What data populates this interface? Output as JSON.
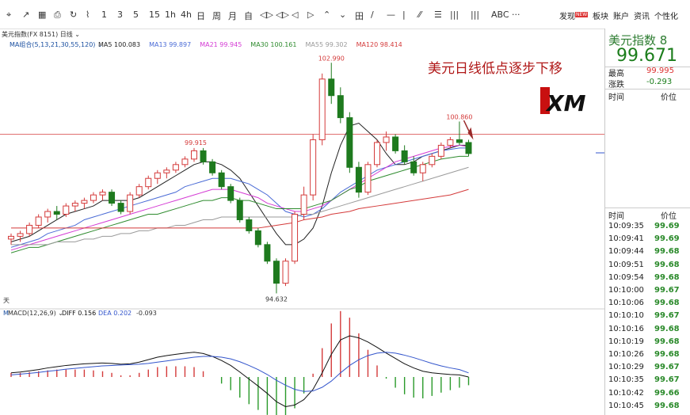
{
  "toolbar": {
    "icons": [
      "draw-crosshair-icon",
      "draw-ray-icon",
      "draw-box-icon",
      "save-icon",
      "refresh-icon",
      "chart-type-icon"
    ],
    "periods": [
      "1",
      "3",
      "5",
      "15",
      "1h",
      "4h",
      "日",
      "周",
      "月",
      "自",
      "◁▷",
      "◁▷",
      "◁",
      "▷",
      "⌃",
      "⌄",
      "田",
      "/",
      "—",
      "|",
      "⁄⁄",
      "☰",
      "|||",
      "|||",
      "ABC",
      "···"
    ],
    "right_items": [
      "发现",
      "板块",
      "账户",
      "资讯",
      "个性化"
    ],
    "discover_badge": "NEW"
  },
  "chart_header": {
    "symbol": "美元指数(FX 8151)",
    "period": "日线",
    "ma_label": "MA组合(5,13,21,30,55,120)",
    "ma_values": [
      {
        "name": "MA5",
        "value": "100.083",
        "color": "#222222"
      },
      {
        "name": "MA13",
        "value": "99.897",
        "color": "#4a6bd6"
      },
      {
        "name": "MA21",
        "value": "99.945",
        "color": "#d43bd4"
      },
      {
        "name": "MA30",
        "value": "100.161",
        "color": "#2e8b2e"
      },
      {
        "name": "MA55",
        "value": "99.302",
        "color": "#9a9a9a"
      },
      {
        "name": "MA120",
        "value": "98.414",
        "color": "#d43a3a"
      }
    ]
  },
  "annotation": {
    "headline": "美元日线低点逐步下移",
    "brand": "XM",
    "high_label": "102.990",
    "left_peak_label": "99.915",
    "low_label": "94.632",
    "recent_label": "100.860",
    "tian": "天"
  },
  "macd_header": {
    "label": "MACD(12,26,9)",
    "diff_name": "DIFF",
    "diff_value": "0.156",
    "dea_name": "DEA",
    "dea_value": "0.202",
    "macd_value": "-0.093"
  },
  "side": {
    "title": "美元指数",
    "title_suffix": "8",
    "price": "99.671",
    "high_label": "最高",
    "high_value": "99.995",
    "chg_label": "涨跌",
    "chg_value": "-0.293",
    "col_time": "时间",
    "col_price": "价位",
    "col_time2": "时间",
    "col_price2": "价位",
    "ticks": [
      {
        "t": "10:09:35",
        "p": "99.69"
      },
      {
        "t": "10:09:41",
        "p": "99.69"
      },
      {
        "t": "10:09:44",
        "p": "99.68"
      },
      {
        "t": "10:09:51",
        "p": "99.68"
      },
      {
        "t": "10:09:54",
        "p": "99.68"
      },
      {
        "t": "10:10:00",
        "p": "99.67"
      },
      {
        "t": "10:10:06",
        "p": "99.68"
      },
      {
        "t": "10:10:10",
        "p": "99.67"
      },
      {
        "t": "10:10:16",
        "p": "99.68"
      },
      {
        "t": "10:10:19",
        "p": "99.68"
      },
      {
        "t": "10:10:26",
        "p": "99.68"
      },
      {
        "t": "10:10:29",
        "p": "99.67"
      },
      {
        "t": "10:10:35",
        "p": "99.67"
      },
      {
        "t": "10:10:42",
        "p": "99.66"
      },
      {
        "t": "10:10:45",
        "p": "99.68"
      }
    ]
  },
  "chart_data": {
    "type": "candlestick",
    "ylim": [
      94.3,
      103.6
    ],
    "resistance_level": 100.4,
    "candles": [
      [
        96.6,
        96.8,
        96.4,
        96.7
      ],
      [
        96.7,
        96.9,
        96.5,
        96.8
      ],
      [
        96.8,
        97.2,
        96.7,
        97.1
      ],
      [
        97.1,
        97.5,
        97.0,
        97.4
      ],
      [
        97.4,
        97.7,
        97.2,
        97.6
      ],
      [
        97.6,
        97.8,
        97.3,
        97.5
      ],
      [
        97.5,
        97.9,
        97.4,
        97.8
      ],
      [
        97.8,
        98.0,
        97.6,
        97.9
      ],
      [
        97.9,
        98.1,
        97.7,
        98.0
      ],
      [
        98.0,
        98.3,
        97.9,
        98.2
      ],
      [
        98.2,
        98.4,
        98.0,
        98.3
      ],
      [
        98.3,
        98.4,
        97.8,
        97.9
      ],
      [
        97.9,
        98.0,
        97.5,
        97.6
      ],
      [
        97.6,
        98.3,
        97.5,
        98.2
      ],
      [
        98.2,
        98.6,
        98.1,
        98.5
      ],
      [
        98.5,
        98.9,
        98.4,
        98.8
      ],
      [
        98.8,
        99.1,
        98.6,
        99.0
      ],
      [
        99.0,
        99.2,
        98.8,
        99.1
      ],
      [
        99.1,
        99.4,
        99.0,
        99.3
      ],
      [
        99.3,
        99.6,
        99.2,
        99.5
      ],
      [
        99.5,
        99.9,
        99.4,
        99.8
      ],
      [
        99.8,
        99.9,
        99.3,
        99.4
      ],
      [
        99.4,
        99.5,
        98.9,
        99.0
      ],
      [
        99.0,
        99.1,
        98.4,
        98.5
      ],
      [
        98.5,
        98.6,
        97.9,
        98.0
      ],
      [
        98.0,
        98.1,
        97.2,
        97.3
      ],
      [
        97.3,
        97.4,
        96.8,
        96.9
      ],
      [
        96.9,
        97.0,
        96.3,
        96.4
      ],
      [
        96.4,
        96.5,
        95.7,
        95.8
      ],
      [
        95.8,
        95.9,
        94.632,
        95.0
      ],
      [
        95.0,
        95.9,
        94.9,
        95.8
      ],
      [
        95.8,
        97.6,
        95.7,
        97.5
      ],
      [
        97.5,
        98.5,
        97.3,
        98.2
      ],
      [
        98.2,
        100.4,
        98.0,
        100.2
      ],
      [
        100.2,
        102.6,
        100.0,
        102.4
      ],
      [
        102.4,
        102.99,
        101.5,
        101.8
      ],
      [
        101.8,
        102.1,
        100.8,
        101.0
      ],
      [
        101.0,
        101.2,
        99.0,
        99.2
      ],
      [
        99.2,
        99.4,
        98.1,
        98.3
      ],
      [
        98.3,
        99.4,
        98.2,
        99.3
      ],
      [
        99.3,
        100.2,
        99.2,
        100.1
      ],
      [
        100.1,
        100.5,
        99.8,
        100.3
      ],
      [
        100.3,
        100.4,
        99.7,
        99.8
      ],
      [
        99.8,
        100.0,
        99.3,
        99.4
      ],
      [
        99.4,
        99.6,
        98.9,
        99.0
      ],
      [
        99.0,
        99.4,
        98.7,
        99.3
      ],
      [
        99.3,
        99.7,
        99.2,
        99.6
      ],
      [
        99.6,
        100.1,
        99.5,
        100.0
      ],
      [
        100.0,
        100.3,
        99.9,
        100.2
      ],
      [
        100.2,
        100.86,
        100.0,
        100.1
      ],
      [
        100.1,
        100.2,
        99.6,
        99.7
      ]
    ],
    "series": [
      {
        "name": "MA5",
        "color": "#222222",
        "values": [
          96.5,
          96.6,
          96.7,
          96.9,
          97.1,
          97.3,
          97.5,
          97.6,
          97.7,
          97.8,
          98.0,
          98.0,
          98.0,
          98.0,
          98.1,
          98.3,
          98.5,
          98.7,
          98.9,
          99.1,
          99.3,
          99.4,
          99.4,
          99.3,
          99.1,
          98.8,
          98.3,
          97.8,
          97.3,
          96.8,
          96.4,
          96.4,
          96.6,
          97.0,
          97.8,
          99.0,
          100.0,
          100.7,
          100.8,
          100.5,
          100.2,
          99.7,
          99.3,
          99.3,
          99.4,
          99.6,
          99.7,
          99.8,
          99.9,
          100.0,
          100.0
        ]
      },
      {
        "name": "MA13",
        "color": "#4a6bd6",
        "values": [
          96.3,
          96.4,
          96.5,
          96.6,
          96.8,
          96.9,
          97.0,
          97.1,
          97.3,
          97.4,
          97.5,
          97.6,
          97.7,
          97.8,
          97.9,
          98.0,
          98.1,
          98.2,
          98.3,
          98.5,
          98.6,
          98.7,
          98.8,
          98.8,
          98.8,
          98.7,
          98.6,
          98.4,
          98.2,
          97.9,
          97.6,
          97.5,
          97.4,
          97.5,
          97.7,
          98.0,
          98.3,
          98.5,
          98.7,
          98.9,
          99.1,
          99.2,
          99.3,
          99.4,
          99.5,
          99.6,
          99.7,
          99.8,
          99.85,
          99.9,
          99.9
        ]
      },
      {
        "name": "MA21",
        "color": "#d43bd4",
        "values": [
          96.2,
          96.3,
          96.4,
          96.5,
          96.6,
          96.7,
          96.8,
          96.9,
          97.0,
          97.1,
          97.2,
          97.3,
          97.4,
          97.5,
          97.6,
          97.7,
          97.8,
          97.9,
          98.0,
          98.1,
          98.2,
          98.3,
          98.4,
          98.4,
          98.4,
          98.3,
          98.2,
          98.1,
          97.9,
          97.8,
          97.7,
          97.6,
          97.6,
          97.7,
          97.8,
          98.0,
          98.2,
          98.4,
          98.6,
          98.8,
          99.0,
          99.2,
          99.4,
          99.5,
          99.6,
          99.7,
          99.8,
          99.9,
          99.95,
          100.0,
          99.95
        ]
      },
      {
        "name": "MA30",
        "color": "#2e8b2e",
        "values": [
          96.1,
          96.2,
          96.3,
          96.3,
          96.4,
          96.5,
          96.6,
          96.7,
          96.8,
          96.9,
          97.0,
          97.1,
          97.2,
          97.3,
          97.4,
          97.5,
          97.5,
          97.6,
          97.7,
          97.8,
          97.9,
          98.0,
          98.0,
          98.1,
          98.1,
          98.0,
          98.0,
          97.9,
          97.8,
          97.7,
          97.7,
          97.7,
          97.7,
          97.8,
          97.9,
          98.0,
          98.2,
          98.4,
          98.5,
          98.7,
          98.8,
          98.9,
          99.0,
          99.1,
          99.2,
          99.3,
          99.4,
          99.5,
          99.55,
          99.6,
          99.6
        ]
      },
      {
        "name": "MA55",
        "color": "#9a9a9a",
        "values": [
          96.4,
          96.4,
          96.4,
          96.4,
          96.4,
          96.5,
          96.5,
          96.5,
          96.6,
          96.6,
          96.7,
          96.7,
          96.8,
          96.8,
          96.9,
          96.9,
          97.0,
          97.0,
          97.1,
          97.1,
          97.2,
          97.3,
          97.3,
          97.4,
          97.4,
          97.4,
          97.4,
          97.4,
          97.4,
          97.4,
          97.4,
          97.4,
          97.5,
          97.5,
          97.6,
          97.7,
          97.8,
          97.9,
          98.0,
          98.1,
          98.2,
          98.3,
          98.4,
          98.5,
          98.6,
          98.7,
          98.8,
          98.9,
          99.0,
          99.1,
          99.2
        ]
      },
      {
        "name": "MA120",
        "color": "#d43a3a",
        "values": [
          97.0,
          97.0,
          97.0,
          97.0,
          97.0,
          97.0,
          97.0,
          97.0,
          97.0,
          97.0,
          97.0,
          97.0,
          97.0,
          97.0,
          97.0,
          97.0,
          97.0,
          97.0,
          97.0,
          97.0,
          97.0,
          97.0,
          97.0,
          97.0,
          97.0,
          97.0,
          97.0,
          97.0,
          97.05,
          97.1,
          97.15,
          97.2,
          97.3,
          97.35,
          97.4,
          97.5,
          97.55,
          97.6,
          97.7,
          97.75,
          97.8,
          97.85,
          97.9,
          97.95,
          98.0,
          98.05,
          98.1,
          98.15,
          98.2,
          98.3,
          98.4
        ]
      }
    ],
    "macd": {
      "diff": [
        0.1,
        0.12,
        0.15,
        0.18,
        0.22,
        0.25,
        0.28,
        0.3,
        0.32,
        0.33,
        0.34,
        0.33,
        0.31,
        0.32,
        0.36,
        0.42,
        0.48,
        0.52,
        0.55,
        0.58,
        0.6,
        0.57,
        0.5,
        0.4,
        0.28,
        0.12,
        -0.05,
        -0.22,
        -0.4,
        -0.6,
        -0.72,
        -0.68,
        -0.55,
        -0.3,
        0.1,
        0.55,
        0.9,
        1.0,
        0.95,
        0.85,
        0.72,
        0.58,
        0.45,
        0.32,
        0.22,
        0.14,
        0.1,
        0.08,
        0.06,
        0.05,
        0.0
      ],
      "dea": [
        0.05,
        0.07,
        0.09,
        0.11,
        0.14,
        0.16,
        0.19,
        0.21,
        0.23,
        0.25,
        0.27,
        0.28,
        0.29,
        0.3,
        0.31,
        0.33,
        0.36,
        0.39,
        0.42,
        0.45,
        0.48,
        0.5,
        0.5,
        0.48,
        0.44,
        0.37,
        0.28,
        0.18,
        0.06,
        -0.08,
        -0.2,
        -0.3,
        -0.35,
        -0.34,
        -0.25,
        -0.1,
        0.1,
        0.28,
        0.42,
        0.52,
        0.58,
        0.6,
        0.58,
        0.53,
        0.47,
        0.4,
        0.33,
        0.27,
        0.22,
        0.18,
        0.1
      ],
      "hist": [
        0.1,
        0.1,
        0.12,
        0.14,
        0.16,
        0.18,
        0.18,
        0.18,
        0.18,
        0.16,
        0.14,
        0.1,
        0.04,
        0.04,
        0.1,
        0.18,
        0.24,
        0.26,
        0.26,
        0.26,
        0.24,
        0.14,
        0.0,
        -0.16,
        -0.32,
        -0.5,
        -0.66,
        -0.8,
        -0.92,
        -1.04,
        -1.04,
        -0.76,
        -0.4,
        0.08,
        0.7,
        1.3,
        1.6,
        1.44,
        1.06,
        0.66,
        0.28,
        -0.04,
        -0.26,
        -0.42,
        -0.5,
        -0.52,
        -0.46,
        -0.38,
        -0.32,
        -0.26,
        -0.2
      ]
    }
  }
}
